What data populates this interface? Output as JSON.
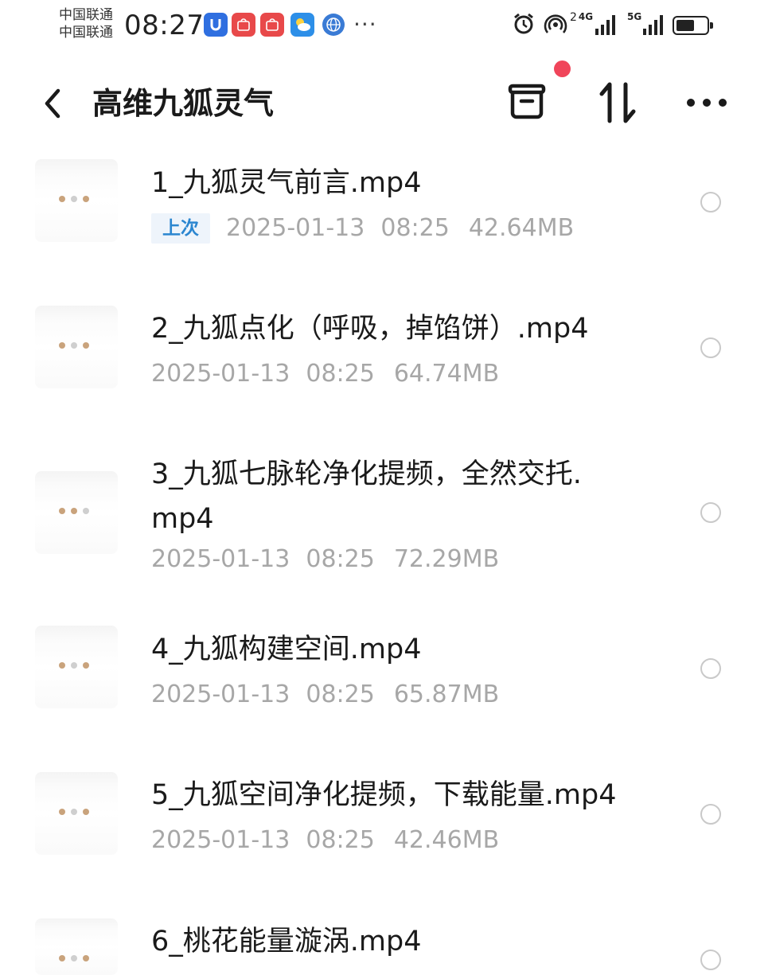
{
  "status_bar": {
    "carrier_1": "中国联通",
    "carrier_2": "中国联通",
    "time": "08:27",
    "notification_icons": [
      "u-app-icon",
      "huawei-icon",
      "huawei-icon",
      "weather-icon",
      "globe-icon"
    ],
    "overflow": "···",
    "hotspot_badge": "2",
    "network_1": "4G",
    "network_2": "5G"
  },
  "header": {
    "title": "高维九狐灵气",
    "actions": [
      "back-icon",
      "archive-icon",
      "sort-icon",
      "more-icon"
    ],
    "has_notification_dot": true
  },
  "files": [
    {
      "name": "1_九狐灵气前言.mp4",
      "badge": "上次",
      "date": "2025-01-13",
      "time": "08:25",
      "size": "42.64MB"
    },
    {
      "name": "2_九狐点化（呼吸，掉馅饼）.mp4",
      "badge": "",
      "date": "2025-01-13",
      "time": "08:25",
      "size": "64.74MB"
    },
    {
      "name": "3_九狐七脉轮净化提频，全然交托.mp4",
      "badge": "",
      "date": "2025-01-13",
      "time": "08:25",
      "size": "72.29MB"
    },
    {
      "name": "4_九狐构建空间.mp4",
      "badge": "",
      "date": "2025-01-13",
      "time": "08:25",
      "size": "65.87MB"
    },
    {
      "name": "5_九狐空间净化提频，下载能量.mp4",
      "badge": "",
      "date": "2025-01-13",
      "time": "08:25",
      "size": "42.46MB"
    },
    {
      "name": "6_桃花能量漩涡.mp4",
      "badge": "",
      "date": "",
      "time": "",
      "size": ""
    }
  ],
  "colors": {
    "badge_text": "#2b86d0",
    "badge_bg": "#eef4fb",
    "meta_text": "#a7a7a7",
    "notification_dot": "#f0455a"
  }
}
